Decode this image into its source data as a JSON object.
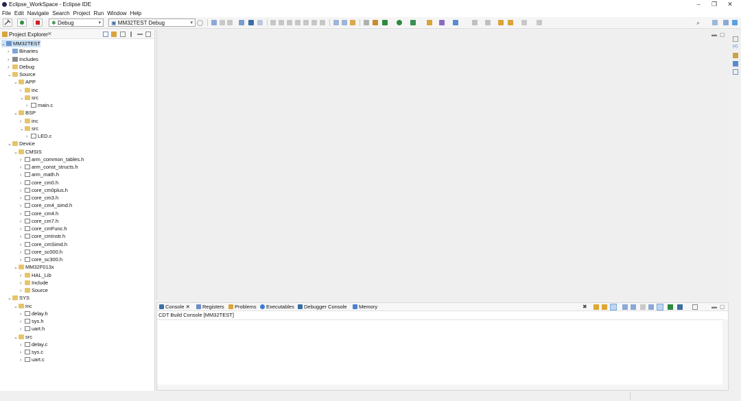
{
  "window": {
    "title": "Eclipse_WorkSpace - Eclipse IDE",
    "minimize": "–",
    "restore": "❐",
    "close": "✕"
  },
  "menu": [
    "File",
    "Edit",
    "Navigate",
    "Search",
    "Project",
    "Run",
    "Window",
    "Help"
  ],
  "toolbar": {
    "launch_mode": "Debug",
    "launch_config": "MM32TEST Debug"
  },
  "explorer": {
    "title": "Project Explorer",
    "close_glyph": "✕",
    "tree": [
      {
        "label": "MM32TEST",
        "depth": 0,
        "expanded": true,
        "type": "project",
        "selected": true
      },
      {
        "label": "Binaries",
        "depth": 1,
        "expanded": false,
        "type": "binaries"
      },
      {
        "label": "Includes",
        "depth": 1,
        "expanded": false,
        "type": "includes"
      },
      {
        "label": "Debug",
        "depth": 1,
        "expanded": false,
        "type": "folder"
      },
      {
        "label": "Source",
        "depth": 1,
        "expanded": true,
        "type": "folder"
      },
      {
        "label": "APP",
        "depth": 2,
        "expanded": true,
        "type": "folder"
      },
      {
        "label": "inc",
        "depth": 3,
        "expanded": false,
        "type": "folder"
      },
      {
        "label": "src",
        "depth": 3,
        "expanded": true,
        "type": "folder"
      },
      {
        "label": "main.c",
        "depth": 4,
        "expanded": false,
        "type": "c"
      },
      {
        "label": "BSP",
        "depth": 2,
        "expanded": true,
        "type": "folder"
      },
      {
        "label": "inc",
        "depth": 3,
        "expanded": false,
        "type": "folder"
      },
      {
        "label": "src",
        "depth": 3,
        "expanded": true,
        "type": "folder"
      },
      {
        "label": "LED.c",
        "depth": 4,
        "expanded": false,
        "type": "c"
      },
      {
        "label": "Device",
        "depth": 1,
        "expanded": true,
        "type": "folder"
      },
      {
        "label": "CMSIS",
        "depth": 2,
        "expanded": true,
        "type": "folder"
      },
      {
        "label": "arm_common_tables.h",
        "depth": 3,
        "expanded": false,
        "type": "h"
      },
      {
        "label": "arm_const_structs.h",
        "depth": 3,
        "expanded": false,
        "type": "h"
      },
      {
        "label": "arm_math.h",
        "depth": 3,
        "expanded": false,
        "type": "h"
      },
      {
        "label": "core_cm0.h",
        "depth": 3,
        "expanded": false,
        "type": "h"
      },
      {
        "label": "core_cm0plus.h",
        "depth": 3,
        "expanded": false,
        "type": "h"
      },
      {
        "label": "core_cm3.h",
        "depth": 3,
        "expanded": false,
        "type": "h"
      },
      {
        "label": "core_cm4_simd.h",
        "depth": 3,
        "expanded": false,
        "type": "h"
      },
      {
        "label": "core_cm4.h",
        "depth": 3,
        "expanded": false,
        "type": "h"
      },
      {
        "label": "core_cm7.h",
        "depth": 3,
        "expanded": false,
        "type": "h"
      },
      {
        "label": "core_cmFunc.h",
        "depth": 3,
        "expanded": false,
        "type": "h"
      },
      {
        "label": "core_cmInstr.h",
        "depth": 3,
        "expanded": false,
        "type": "h"
      },
      {
        "label": "core_cmSimd.h",
        "depth": 3,
        "expanded": false,
        "type": "h"
      },
      {
        "label": "core_sc000.h",
        "depth": 3,
        "expanded": false,
        "type": "h"
      },
      {
        "label": "core_sc300.h",
        "depth": 3,
        "expanded": false,
        "type": "h"
      },
      {
        "label": "MM32F013x",
        "depth": 2,
        "expanded": true,
        "type": "folder"
      },
      {
        "label": "HAL_Lib",
        "depth": 3,
        "expanded": false,
        "type": "folder"
      },
      {
        "label": "Include",
        "depth": 3,
        "expanded": false,
        "type": "folder"
      },
      {
        "label": "Source",
        "depth": 3,
        "expanded": false,
        "type": "folder"
      },
      {
        "label": "SYS",
        "depth": 1,
        "expanded": true,
        "type": "folder"
      },
      {
        "label": "inc",
        "depth": 2,
        "expanded": true,
        "type": "folder"
      },
      {
        "label": "delay.h",
        "depth": 3,
        "expanded": false,
        "type": "h"
      },
      {
        "label": "sys.h",
        "depth": 3,
        "expanded": false,
        "type": "h"
      },
      {
        "label": "uart.h",
        "depth": 3,
        "expanded": false,
        "type": "h"
      },
      {
        "label": "src",
        "depth": 2,
        "expanded": true,
        "type": "folder"
      },
      {
        "label": "delay.c",
        "depth": 3,
        "expanded": false,
        "type": "c"
      },
      {
        "label": "sys.c",
        "depth": 3,
        "expanded": false,
        "type": "c"
      },
      {
        "label": "uart.c",
        "depth": 3,
        "expanded": false,
        "type": "c"
      }
    ]
  },
  "console": {
    "tabs": [
      {
        "label": "Console",
        "icon": "console-icon",
        "color": "#3a6ea5"
      },
      {
        "label": "Registers",
        "icon": "registers-icon",
        "color": "#6a8cc8"
      },
      {
        "label": "Problems",
        "icon": "problems-icon",
        "color": "#d9a43a"
      },
      {
        "label": "Executables",
        "icon": "executables-icon",
        "color": "#3b7bd6"
      },
      {
        "label": "Debugger Console",
        "icon": "debugger-console-icon",
        "color": "#3a6ea5"
      },
      {
        "label": "Memory",
        "icon": "memory-icon",
        "color": "#4c7fd0"
      }
    ],
    "console_close": "✕",
    "header_line": "CDT Build Console [MM32TEST]"
  },
  "colors": {
    "selection": "#cde3f7",
    "folder": "#e7c46a",
    "debug_green": "#2e8b3d",
    "terminate_red": "#cc2222"
  }
}
